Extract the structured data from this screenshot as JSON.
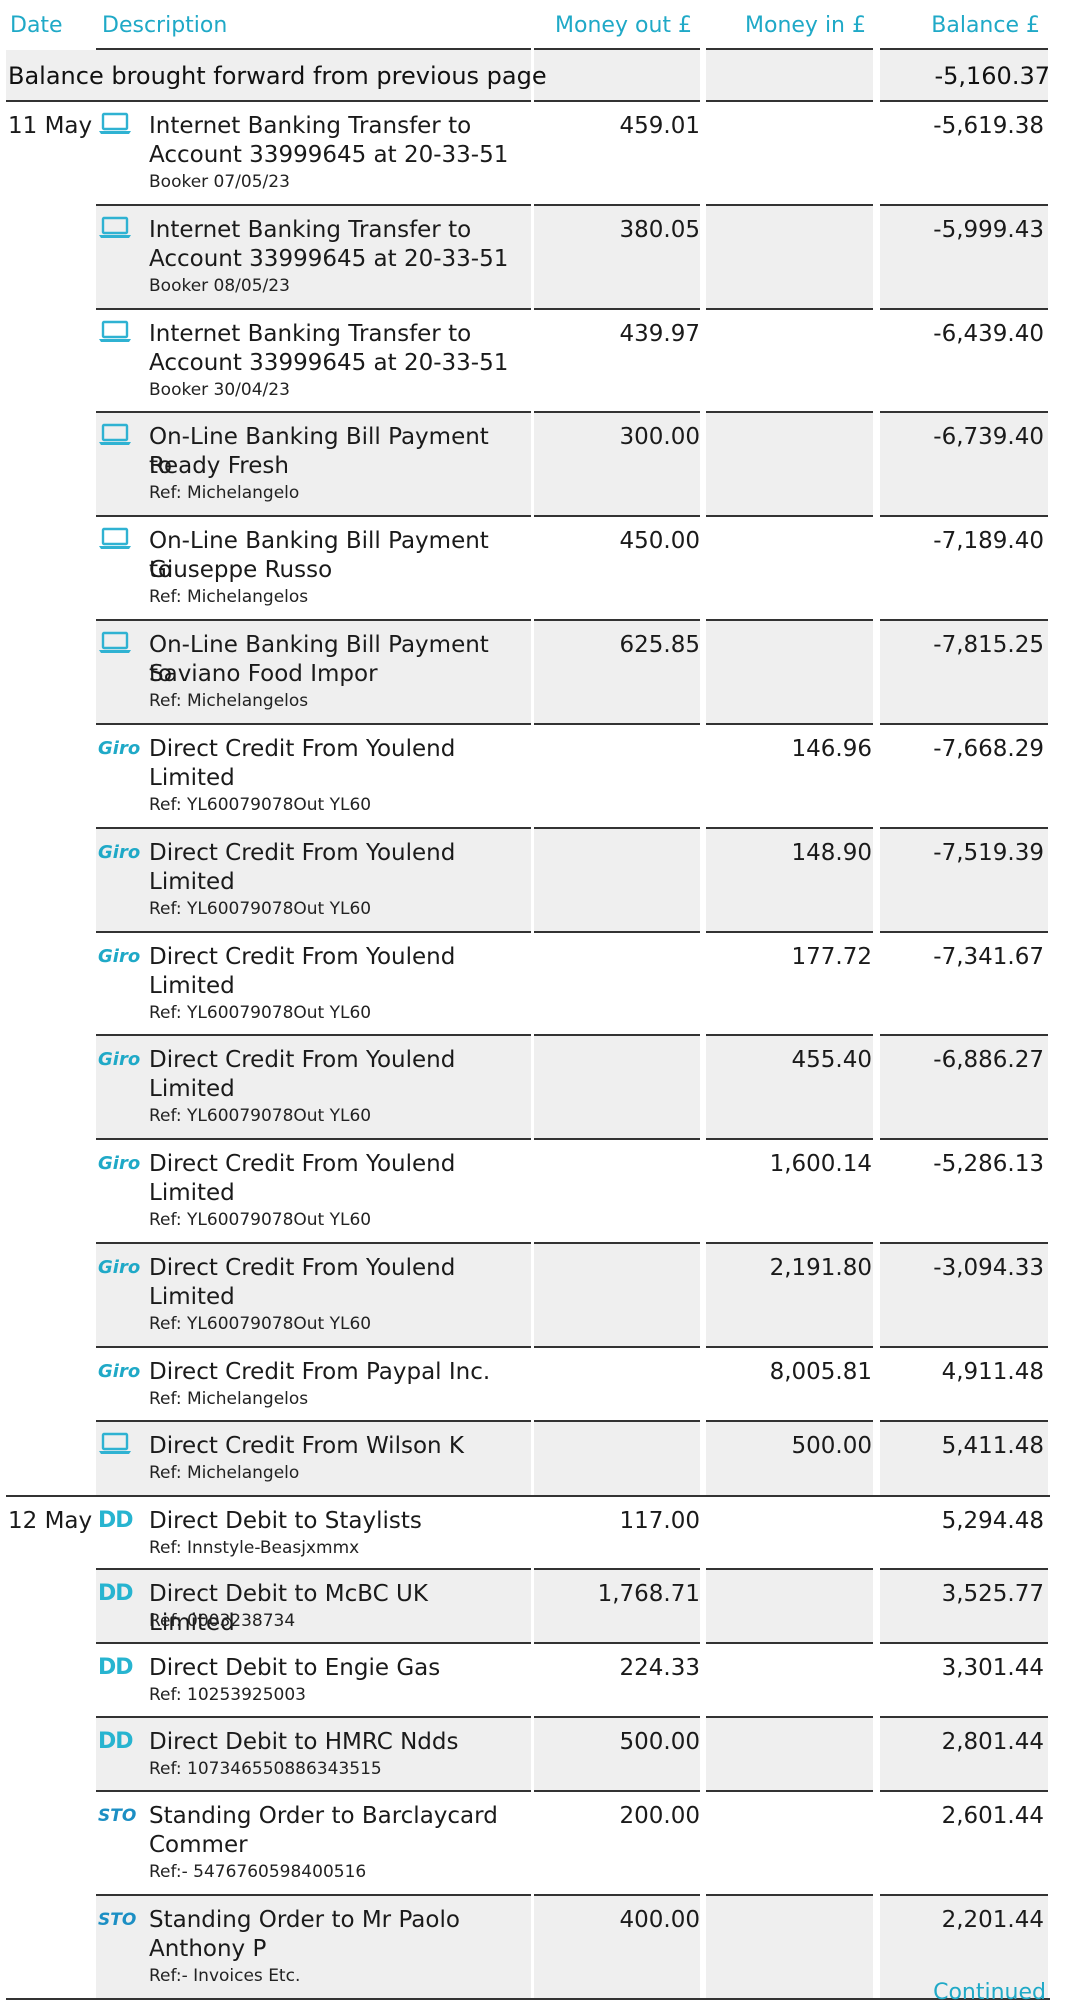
{
  "header": {
    "date": "Date",
    "description": "Description",
    "money_out": "Money out £",
    "money_in": "Money in £",
    "balance": "Balance £"
  },
  "brought_forward": {
    "label": "Balance brought forward from previous page",
    "balance": "-5,160.37"
  },
  "transactions": [
    {
      "date": "11 May",
      "icon": "laptop-icon",
      "lines": [
        "Internet Banking Transfer to",
        "Account 33999645 at 20-33-51"
      ],
      "ref": "Booker 07/05/23",
      "out": "459.01",
      "in": "",
      "balance": "-5,619.38"
    },
    {
      "date": "",
      "icon": "laptop-icon",
      "lines": [
        "Internet Banking Transfer to",
        "Account 33999645 at 20-33-51"
      ],
      "ref": "Booker 08/05/23",
      "out": "380.05",
      "in": "",
      "balance": "-5,999.43"
    },
    {
      "date": "",
      "icon": "laptop-icon",
      "lines": [
        "Internet Banking Transfer to",
        "Account 33999645 at 20-33-51"
      ],
      "ref": "Booker 30/04/23",
      "out": "439.97",
      "in": "",
      "balance": "-6,439.40"
    },
    {
      "date": "",
      "icon": "laptop-icon",
      "lines": [
        "On-Line Banking Bill Payment to",
        "Ready Fresh"
      ],
      "ref": "Ref: Michelangelo",
      "out": "300.00",
      "in": "",
      "balance": "-6,739.40"
    },
    {
      "date": "",
      "icon": "laptop-icon",
      "lines": [
        "On-Line Banking Bill Payment to",
        "Giuseppe Russo"
      ],
      "ref": "Ref: Michelangelos",
      "out": "450.00",
      "in": "",
      "balance": "-7,189.40"
    },
    {
      "date": "",
      "icon": "laptop-icon",
      "lines": [
        "On-Line Banking Bill Payment to",
        "Saviano Food Impor"
      ],
      "ref": "Ref: Michelangelos",
      "out": "625.85",
      "in": "",
      "balance": "-7,815.25"
    },
    {
      "date": "",
      "icon": "giro-icon",
      "icon_text": "Giro",
      "lines": [
        "Direct Credit From Youlend",
        "Limited"
      ],
      "ref": "Ref: YL60079078Out YL60",
      "out": "",
      "in": "146.96",
      "balance": "-7,668.29"
    },
    {
      "date": "",
      "icon": "giro-icon",
      "icon_text": "Giro",
      "lines": [
        "Direct Credit From Youlend",
        "Limited"
      ],
      "ref": "Ref: YL60079078Out YL60",
      "out": "",
      "in": "148.90",
      "balance": "-7,519.39"
    },
    {
      "date": "",
      "icon": "giro-icon",
      "icon_text": "Giro",
      "lines": [
        "Direct Credit From Youlend",
        "Limited"
      ],
      "ref": "Ref: YL60079078Out YL60",
      "out": "",
      "in": "177.72",
      "balance": "-7,341.67"
    },
    {
      "date": "",
      "icon": "giro-icon",
      "icon_text": "Giro",
      "lines": [
        "Direct Credit From Youlend",
        "Limited"
      ],
      "ref": "Ref: YL60079078Out YL60",
      "out": "",
      "in": "455.40",
      "balance": "-6,886.27"
    },
    {
      "date": "",
      "icon": "giro-icon",
      "icon_text": "Giro",
      "lines": [
        "Direct Credit From Youlend",
        "Limited"
      ],
      "ref": "Ref: YL60079078Out YL60",
      "out": "",
      "in": "1,600.14",
      "balance": "-5,286.13"
    },
    {
      "date": "",
      "icon": "giro-icon",
      "icon_text": "Giro",
      "lines": [
        "Direct Credit From Youlend",
        "Limited"
      ],
      "ref": "Ref: YL60079078Out YL60",
      "out": "",
      "in": "2,191.80",
      "balance": "-3,094.33"
    },
    {
      "date": "",
      "icon": "giro-icon",
      "icon_text": "Giro",
      "lines": [
        "Direct Credit From Paypal Inc."
      ],
      "ref": "Ref: Michelangelos",
      "out": "",
      "in": "8,005.81",
      "balance": "4,911.48"
    },
    {
      "date": "",
      "icon": "laptop-icon",
      "lines": [
        "Direct Credit From Wilson K"
      ],
      "ref": "Ref: Michelangelo",
      "out": "",
      "in": "500.00",
      "balance": "5,411.48"
    },
    {
      "date": "12 May",
      "icon": "dd-icon",
      "icon_text": "DD",
      "lines": [
        "Direct Debit to Staylists"
      ],
      "ref": "Ref: Innstyle-Beasjxmmx",
      "out": "117.00",
      "in": "",
      "balance": "5,294.48"
    },
    {
      "date": "",
      "icon": "dd-icon",
      "icon_text": "DD",
      "lines": [
        "Direct Debit to McBC UK Limited"
      ],
      "ref": "Ref: 0003238734",
      "out": "1,768.71",
      "in": "",
      "balance": "3,525.77"
    },
    {
      "date": "",
      "icon": "dd-icon",
      "icon_text": "DD",
      "lines": [
        "Direct Debit to Engie Gas"
      ],
      "ref": "Ref: 10253925003",
      "out": "224.33",
      "in": "",
      "balance": "3,301.44"
    },
    {
      "date": "",
      "icon": "dd-icon",
      "icon_text": "DD",
      "lines": [
        "Direct Debit to HMRC Ndds"
      ],
      "ref": "Ref: 107346550886343515",
      "out": "500.00",
      "in": "",
      "balance": "2,801.44"
    },
    {
      "date": "",
      "icon": "sto-icon",
      "icon_text": "STO",
      "lines": [
        "Standing Order to Barclaycard",
        "Commer"
      ],
      "ref": "Ref:- 5476760598400516",
      "out": "200.00",
      "in": "",
      "balance": "2,601.44"
    },
    {
      "date": "",
      "icon": "sto-icon",
      "icon_text": "STO",
      "lines": [
        "Standing Order to Mr Paolo",
        "Anthony P"
      ],
      "ref": "Ref:- Invoices Etc.",
      "out": "400.00",
      "in": "",
      "balance": "2,201.44"
    }
  ],
  "footer": {
    "continued": "Continued"
  },
  "colors": {
    "accent": "#1fa9c7",
    "row_shade": "#efefef",
    "rule": "#333333"
  }
}
